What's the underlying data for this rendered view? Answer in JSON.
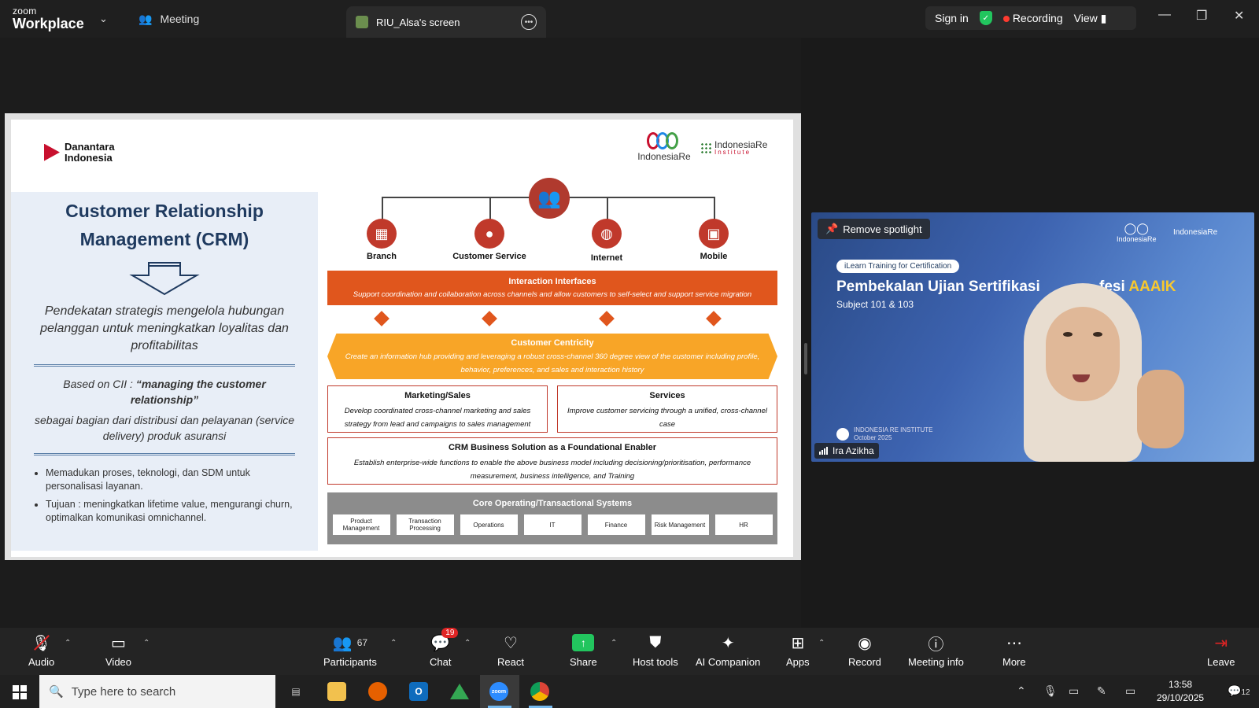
{
  "window": {
    "app_brand_top": "zoom",
    "app_brand_bottom": "Workplace",
    "meeting_tab": "Meeting",
    "screen_tab": "RIU_Alsa's screen",
    "sign_in": "Sign in",
    "recording": "Recording",
    "view": "View"
  },
  "slide": {
    "logo_left": "Danantara Indonesia",
    "logo_right_1": "IndonesiaRe",
    "logo_right_2": "IndonesiaRe",
    "logo_right_2_sub": "Institute",
    "title": "Customer Relationship Management (CRM)",
    "intro": "Pendekatan strategis mengelola hubungan pelanggan untuk meningkatkan loyalitas dan profitabilitas",
    "based_on_prefix": "Based on CII : ",
    "based_on_quote": "“managing the customer relationship”",
    "based_on_rest": "sebagai bagian dari distribusi dan pelayanan (service delivery) produk asuransi",
    "bullets": [
      "Memadukan proses, teknologi, dan SDM untuk personalisasi layanan.",
      "Tujuan : meningkatkan lifetime value, mengurangi churn, optimalkan komunikasi omnichannel."
    ],
    "channels": [
      "Branch",
      "Customer Service",
      "Internet",
      "Mobile"
    ],
    "interaction_title": "Interaction Interfaces",
    "interaction_desc": "Support coordination and collaboration across channels and allow customers to self-select and support service migration",
    "centricity_title": "Customer Centricity",
    "centricity_desc": "Create an information hub providing and leveraging a robust cross-channel 360 degree view of the customer including profile, behavior, preferences, and sales and interaction history",
    "marketing_title": "Marketing/Sales",
    "marketing_desc": "Develop coordinated cross-channel marketing and sales strategy from lead and campaigns to sales management",
    "services_title": "Services",
    "services_desc": "Improve customer servicing through a unified, cross-channel case",
    "crm_title": "CRM Business Solution as a Foundational Enabler",
    "crm_desc": "Establish enterprise-wide functions to enable the above business model including decisioning/prioritisation, performance measurement, business intelligence, and Training",
    "core_title": "Core Operating/Transactional Systems",
    "core_items": [
      "Product Management",
      "Transaction Processing",
      "Operations",
      "IT",
      "Finance",
      "Risk Management",
      "HR"
    ]
  },
  "video": {
    "remove_spotlight": "Remove spotlight",
    "badge": "iLearn Training for Certification",
    "title_visible": "Pembekalan Ujian Sertifikasi ",
    "title_tail": "fesi ",
    "title_highlight": "AAAIK",
    "subtitle": "Subject 101 & 103",
    "brand_1": "IndonesiaRe",
    "brand_2": "IndonesiaRe",
    "footer_1": "INDONESIA RE INSTITUTE",
    "footer_2": "October 2025",
    "participant_name": "Ira Azikha"
  },
  "toolbar": {
    "audio": "Audio",
    "video": "Video",
    "participants": "Participants",
    "participants_count": "67",
    "chat": "Chat",
    "chat_badge": "19",
    "react": "React",
    "share": "Share",
    "host_tools": "Host tools",
    "ai_companion": "AI Companion",
    "apps": "Apps",
    "record": "Record",
    "meeting_info": "Meeting info",
    "more": "More",
    "leave": "Leave"
  },
  "taskbar": {
    "search_placeholder": "Type here to search",
    "time": "13:58",
    "date": "29/10/2025",
    "notification_count": "12"
  }
}
